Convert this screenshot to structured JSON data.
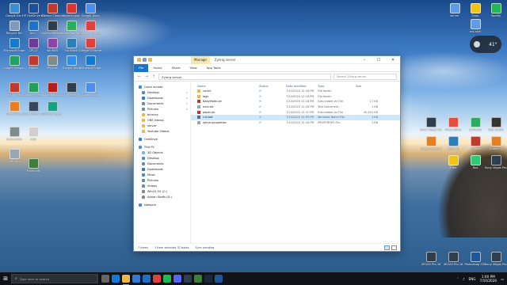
{
  "desktop": {
    "icons": [
      {
        "label": "Google Ear..",
        "color": "#3b8ed6"
      },
      {
        "label": "HP OneDrive Assistant",
        "color": "#1f4e99"
      },
      {
        "label": "8Tresor Cleanable",
        "color": "#c0392b"
      },
      {
        "label": "tutorial.psd",
        "color": "#d33"
      },
      {
        "label": "Google-Docs",
        "color": "#4d8df2"
      },
      {
        "label": "Recycle Bin",
        "color": "#7a9cc0"
      },
      {
        "label": "Acc..",
        "color": "#1d73c9"
      },
      {
        "label": "OneLiveDesktop",
        "color": "#2c3e50"
      },
      {
        "label": "WhatsApp Account",
        "color": "#27ae60"
      },
      {
        "label": "Google Chrome",
        "color": "#e04040"
      },
      {
        "label": "Microsoft Edge",
        "color": "#0f7bd6"
      },
      {
        "label": "CPU-Z",
        "color": "#6c3a9a"
      },
      {
        "label": "WinRAR",
        "color": "#8e44ad"
      },
      {
        "label": "Go Stack",
        "color": "#2980b9"
      },
      {
        "label": "Google Chrome",
        "color": "#e04040"
      },
      {
        "label": "Google Hangouts",
        "color": "#1ea362"
      },
      {
        "label": "Adobe",
        "color": "#c0392b"
      },
      {
        "label": "Picture",
        "color": "#7f8c8d"
      },
      {
        "label": "Google Tools",
        "color": "#2d8ef0"
      },
      {
        "label": "Microsoft Edge",
        "color": "#0f7bd6"
      },
      {
        "label": "Gaming Pack",
        "color": "#c0392b"
      },
      {
        "label": "Google Sheets",
        "color": "#20a05a"
      },
      {
        "label": "Acrobat DC",
        "color": "#b71c1c"
      },
      {
        "label": "Sony Vegas Pro 13",
        "color": "#2c3e50"
      },
      {
        "label": "Google Docs",
        "color": "#4d8df2"
      },
      {
        "label": "Sleep Timer",
        "color": "#e67e22"
      },
      {
        "label": "Sony Vegas 13.0",
        "color": "#34495e"
      },
      {
        "label": "Zylong Vegas",
        "color": "#16a085"
      },
      {
        "label": "Screenshot",
        "color": "#7f8c8d"
      },
      {
        "label": "nebo",
        "color": "#d0d0d0"
      },
      {
        "label": "settings",
        "color": "#9aa6b2"
      },
      {
        "label": "Minecraft",
        "color": "#3f7d3a"
      },
      {
        "label": "Snap",
        "color": "#f1c40f"
      },
      {
        "label": "Spotify",
        "color": "#1db954"
      },
      {
        "label": "server",
        "color": "#5d9cec"
      },
      {
        "label": "ms-skin",
        "color": "#5d9cec"
      },
      {
        "label": "Sony Vegas Pro 13",
        "color": "#2c3e50"
      },
      {
        "label": "Video Editor",
        "color": "#e74c3c"
      },
      {
        "label": "Camtasia",
        "color": "#27ae60"
      },
      {
        "label": "OBS Studio",
        "color": "#333"
      },
      {
        "label": "Adobe Illustrator",
        "color": "#e67e22"
      },
      {
        "label": "Logitech",
        "color": "#2980b9"
      },
      {
        "label": "Games",
        "color": "#c0392b"
      },
      {
        "label": "Audacity",
        "color": "#e67e22"
      },
      {
        "label": "Files",
        "color": "#f1c40f"
      },
      {
        "label": "Nox",
        "color": "#2ecc71"
      },
      {
        "label": "Sony Vegas Pro 14",
        "color": "#2c3e50"
      },
      {
        "label": "VEGAS Pro 16",
        "color": "#2c3e50"
      },
      {
        "label": "VEGAS Pro 18",
        "color": "#2c3e50"
      },
      {
        "label": "Photoshop CS6",
        "color": "#1e5799"
      },
      {
        "label": "Sony Vegas Pro 13",
        "color": "#2c3e50"
      }
    ]
  },
  "weather": {
    "temp": "41°",
    "icon": "cloud-icon"
  },
  "explorer": {
    "title_manage": "Manage",
    "window_title": "Zylerg server",
    "ribbon_tabs": [
      "File",
      "Home",
      "Share",
      "View",
      "App Tools"
    ],
    "address": "Zylerg server",
    "search_placeholder": "Search Zylerg server",
    "quick_access": "Quick access",
    "nav_items": [
      {
        "label": "Desktop",
        "color": "#4a8fd6",
        "pinned": true
      },
      {
        "label": "Downloads",
        "color": "#2a7ad2",
        "pinned": true
      },
      {
        "label": "Documents",
        "color": "#6b8cae",
        "pinned": true
      },
      {
        "label": "Pictures",
        "color": "#6b8cae",
        "pinned": true
      },
      {
        "label": "bineczy",
        "color": "#e8b84a",
        "pinned": false
      },
      {
        "label": "OBS Videos",
        "color": "#e8b84a",
        "pinned": false
      },
      {
        "label": "server",
        "color": "#e8b84a",
        "pinned": false
      },
      {
        "label": "Youtube Videos",
        "color": "#e8b84a",
        "pinned": false
      }
    ],
    "onedrive": "OneDrive",
    "this_pc": "This PC",
    "pc_items": [
      {
        "label": "3D Objects",
        "color": "#7bb3e8"
      },
      {
        "label": "Desktop",
        "color": "#4a8fd6"
      },
      {
        "label": "Documents",
        "color": "#6b8cae"
      },
      {
        "label": "Downloads",
        "color": "#2a7ad2"
      },
      {
        "label": "Music",
        "color": "#4a8fd6"
      },
      {
        "label": "Pictures",
        "color": "#6b8cae"
      },
      {
        "label": "Videos",
        "color": "#6b8cae"
      },
      {
        "label": "Win10 OS (C:)",
        "color": "#888"
      },
      {
        "label": "Adrian Stoffs (D:)",
        "color": "#888"
      }
    ],
    "network": "Network",
    "columns": {
      "name": "Name",
      "status": "Status",
      "date": "Date modified",
      "type": "Type",
      "size": "Size"
    },
    "files": [
      {
        "name": "cache",
        "status": "⟳",
        "date": "7/10/2020 12:18 PM",
        "type": "File folder",
        "size": "",
        "icon": "folder",
        "selected": false
      },
      {
        "name": "logs",
        "status": "⟳",
        "date": "7/10/2020 12:18 PM",
        "type": "File folder",
        "size": "",
        "icon": "folder",
        "selected": false
      },
      {
        "name": "BabyMode.jar",
        "status": "⟳",
        "date": "7/10/2020 12:18 PM",
        "type": "Executable Jar File",
        "size": "17 KB",
        "icon": "jar",
        "selected": false
      },
      {
        "name": "eula.txt",
        "status": "⟳",
        "date": "7/10/2020 12:18 PM",
        "type": "Text Document",
        "size": "1 KB",
        "icon": "txt",
        "selected": false
      },
      {
        "name": "paper.jar",
        "status": "⟳",
        "date": "7/10/2020 12:47 PM",
        "type": "Executable Jar File",
        "size": "40,941 KB",
        "icon": "jar",
        "selected": false
      },
      {
        "name": "run.bat",
        "status": "⟳",
        "date": "7/10/2020 12:59 PM",
        "type": "Windows Batch File",
        "size": "1 KB",
        "icon": "bat",
        "selected": true
      },
      {
        "name": "server.properties",
        "status": "⟳",
        "date": "7/10/2020 12:18 PM",
        "type": "PROPERTIES File",
        "size": "1 KB",
        "icon": "txt",
        "selected": false
      }
    ],
    "status": {
      "count": "7 items",
      "selected": "1 item selected  32 bytes",
      "sync": "Sync pending"
    }
  },
  "taskbar": {
    "search_placeholder": "Type here to search",
    "apps": [
      {
        "name": "task-view",
        "color": "#666",
        "active": false
      },
      {
        "name": "edge",
        "color": "#0f7bd6",
        "active": false
      },
      {
        "name": "file-explorer",
        "color": "#e8b84a",
        "active": true
      },
      {
        "name": "store",
        "color": "#2d7bd6",
        "active": false
      },
      {
        "name": "mail",
        "color": "#1f6fc9",
        "active": false
      },
      {
        "name": "chrome",
        "color": "#e04040",
        "active": false
      },
      {
        "name": "spotify",
        "color": "#1db954",
        "active": false
      },
      {
        "name": "discord",
        "color": "#5865f2",
        "active": false
      },
      {
        "name": "vegas",
        "color": "#2c3e50",
        "active": false
      },
      {
        "name": "minecraft",
        "color": "#3f7d3a",
        "active": false
      },
      {
        "name": "steam",
        "color": "#1b2838",
        "active": false
      },
      {
        "name": "photoshop",
        "color": "#1e5799",
        "active": false
      }
    ],
    "lang": "ENG",
    "time": "1:00 PM",
    "date": "7/10/2020"
  }
}
